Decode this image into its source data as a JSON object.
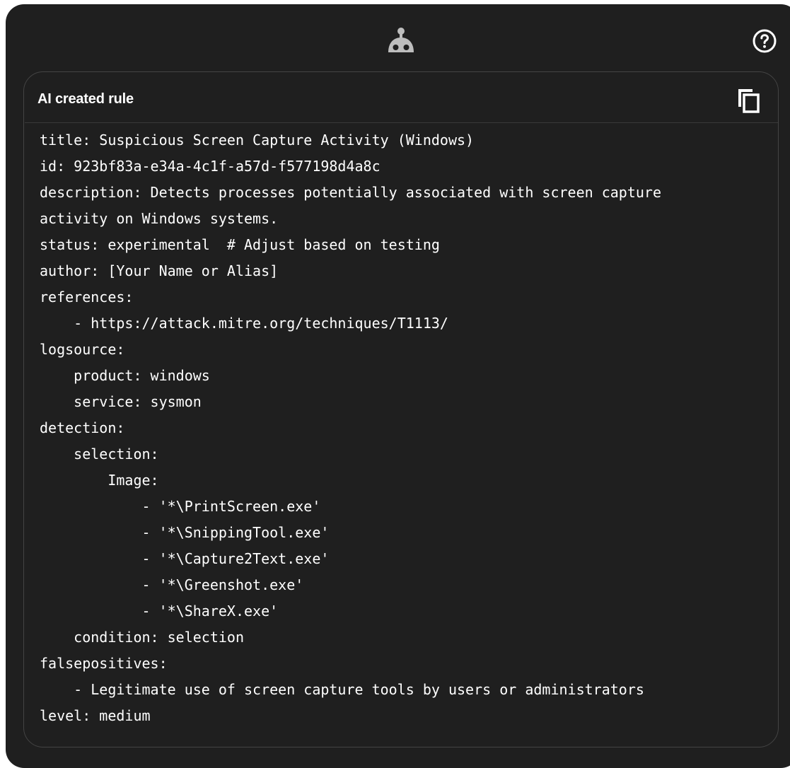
{
  "header": {
    "bot_icon": "robot-icon",
    "help_icon": "help-circle-icon"
  },
  "panel": {
    "title": "AI created rule",
    "copy_icon": "copy-icon"
  },
  "code_lines": [
    "title: Suspicious Screen Capture Activity (Windows)",
    "id: 923bf83a-e34a-4c1f-a57d-f577198d4a8c",
    "description: Detects processes potentially associated with screen capture",
    "activity on Windows systems.",
    "status: experimental  # Adjust based on testing",
    "author: [Your Name or Alias]",
    "references:",
    "    - https://attack.mitre.org/techniques/T1113/",
    "logsource:",
    "    product: windows",
    "    service: sysmon",
    "detection:",
    "    selection:",
    "        Image:",
    "            - '*\\PrintScreen.exe'",
    "            - '*\\SnippingTool.exe'",
    "            - '*\\Capture2Text.exe'",
    "            - '*\\Greenshot.exe'",
    "            - '*\\ShareX.exe'",
    "    condition: selection",
    "falsepositives:",
    "    - Legitimate use of screen capture tools by users or administrators",
    "level: medium"
  ],
  "colors": {
    "background": "#1f1f1f",
    "text": "#ffffff",
    "border": "#444444"
  }
}
